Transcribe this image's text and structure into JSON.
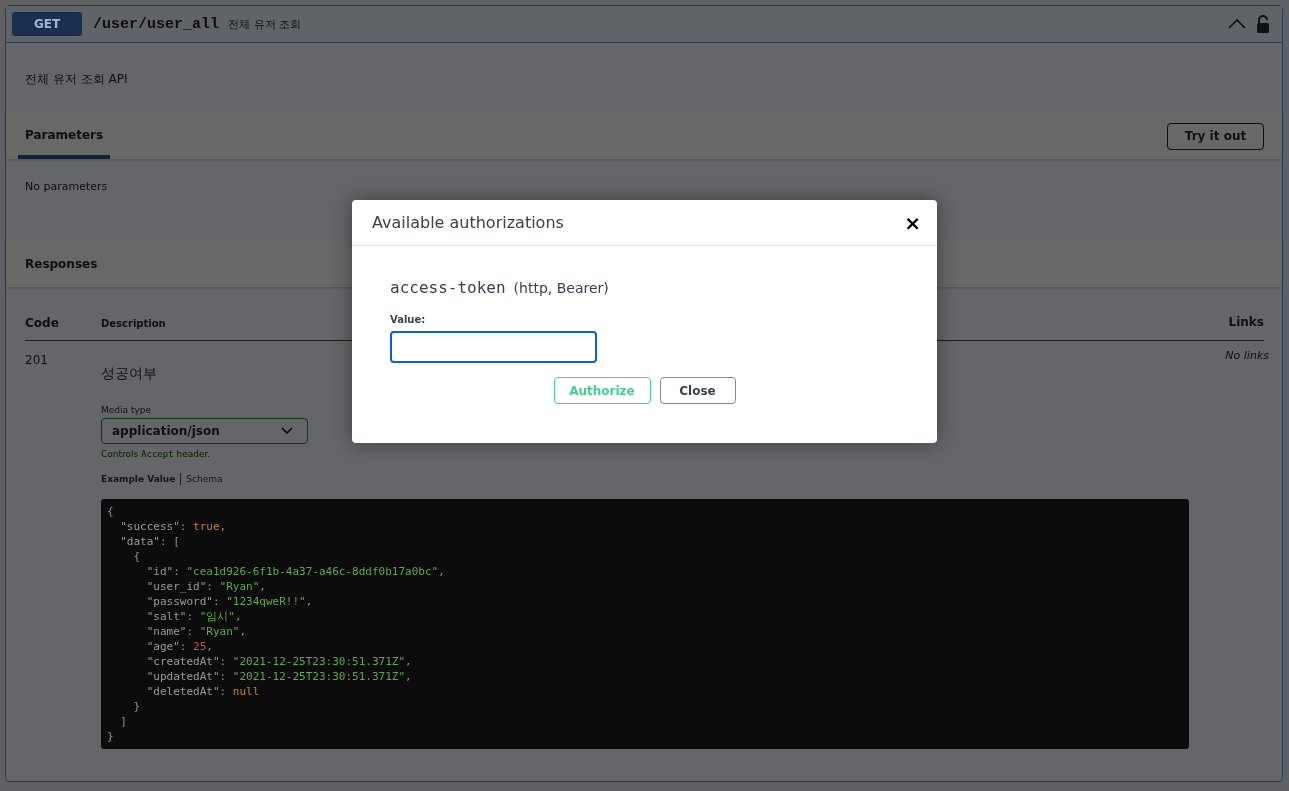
{
  "operation": {
    "method": "GET",
    "path": "/user/user_all",
    "summary": "전체 유저 조회",
    "expanded": true,
    "locked": false
  },
  "description": "전체 유저 조회 API",
  "parameters": {
    "tab": "Parameters",
    "try_button": "Try it out",
    "empty_text": "No parameters"
  },
  "responses": {
    "title": "Responses",
    "columns": [
      "Code",
      "Description",
      "Links"
    ],
    "rows": [
      {
        "code": "201",
        "description": "성공여부",
        "media_type_label": "Media type",
        "media_type": "application/json",
        "controls_note": "Controls **Accept** header.",
        "tabs": [
          {
            "label": "Example Value",
            "selected": true
          },
          {
            "label": "Schema",
            "selected": false
          }
        ],
        "links": "No links",
        "example": [
          [
            {
              "t": "{",
              "kind": "punct"
            }
          ],
          [
            {
              "t": "  \"success\"",
              "kind": "key"
            },
            {
              "t": ": ",
              "kind": "punct"
            },
            {
              "t": "true",
              "kind": "bool"
            },
            {
              "t": ",",
              "kind": "punct"
            }
          ],
          [
            {
              "t": "  \"data\"",
              "kind": "key"
            },
            {
              "t": ": [",
              "kind": "punct"
            }
          ],
          [
            {
              "t": "    {",
              "kind": "punct"
            }
          ],
          [
            {
              "t": "      \"id\"",
              "kind": "key"
            },
            {
              "t": ": ",
              "kind": "punct"
            },
            {
              "t": "\"cea1d926-6f1b-4a37-a46c-8ddf0b17a0bc\"",
              "kind": "string"
            },
            {
              "t": ",",
              "kind": "punct"
            }
          ],
          [
            {
              "t": "      \"user_id\"",
              "kind": "key"
            },
            {
              "t": ": ",
              "kind": "punct"
            },
            {
              "t": "\"Ryan\"",
              "kind": "string"
            },
            {
              "t": ",",
              "kind": "punct"
            }
          ],
          [
            {
              "t": "      \"password\"",
              "kind": "key"
            },
            {
              "t": ": ",
              "kind": "punct"
            },
            {
              "t": "\"1234qweR!!\"",
              "kind": "string"
            },
            {
              "t": ",",
              "kind": "punct"
            }
          ],
          [
            {
              "t": "      \"salt\"",
              "kind": "key"
            },
            {
              "t": ": ",
              "kind": "punct"
            },
            {
              "t": "\"임시\"",
              "kind": "string"
            },
            {
              "t": ",",
              "kind": "punct"
            }
          ],
          [
            {
              "t": "      \"name\"",
              "kind": "key"
            },
            {
              "t": ": ",
              "kind": "punct"
            },
            {
              "t": "\"Ryan\"",
              "kind": "string"
            },
            {
              "t": ",",
              "kind": "punct"
            }
          ],
          [
            {
              "t": "      \"age\"",
              "kind": "key"
            },
            {
              "t": ": ",
              "kind": "punct"
            },
            {
              "t": "25",
              "kind": "number"
            },
            {
              "t": ",",
              "kind": "punct"
            }
          ],
          [
            {
              "t": "      \"createdAt\"",
              "kind": "key"
            },
            {
              "t": ": ",
              "kind": "punct"
            },
            {
              "t": "\"2021-12-25T23:30:51.371Z\"",
              "kind": "string"
            },
            {
              "t": ",",
              "kind": "punct"
            }
          ],
          [
            {
              "t": "      \"updatedAt\"",
              "kind": "key"
            },
            {
              "t": ": ",
              "kind": "punct"
            },
            {
              "t": "\"2021-12-25T23:30:51.371Z\"",
              "kind": "string"
            },
            {
              "t": ",",
              "kind": "punct"
            }
          ],
          [
            {
              "t": "      \"deletedAt\"",
              "kind": "key"
            },
            {
              "t": ": ",
              "kind": "punct"
            },
            {
              "t": "null",
              "kind": "null"
            }
          ],
          [
            {
              "t": "    }",
              "kind": "punct"
            }
          ],
          [
            {
              "t": "  ]",
              "kind": "punct"
            }
          ],
          [
            {
              "t": "}",
              "kind": "punct"
            }
          ]
        ]
      }
    ]
  },
  "modal": {
    "title": "Available authorizations",
    "close_icon": "×",
    "scheme_name": "access-token",
    "scheme_type": "(http, Bearer)",
    "value_label": "Value:",
    "buttons": [
      {
        "label": "Authorize",
        "kind": "primary"
      },
      {
        "label": "Close",
        "kind": "secondary"
      }
    ]
  }
}
